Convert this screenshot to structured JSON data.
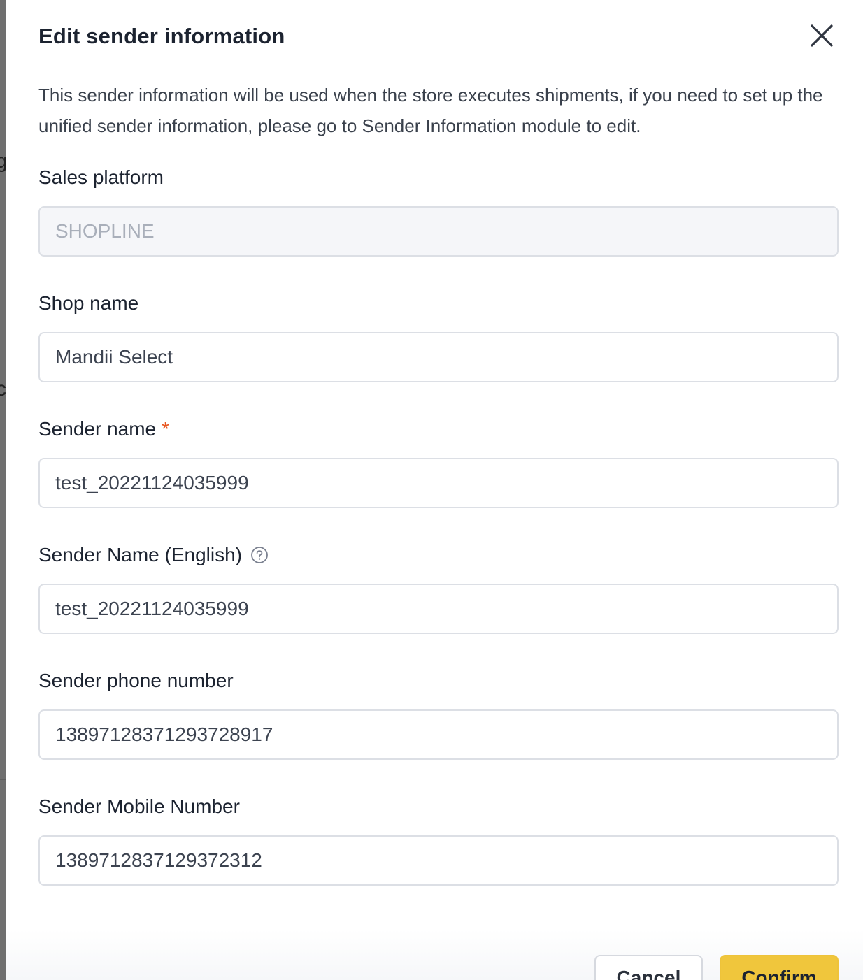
{
  "dialog": {
    "title": "Edit sender information",
    "description": "This sender information will be used when the store executes shipments, if you need to set up the unified sender information, please go to Sender Information module to edit."
  },
  "background": {
    "fragments": [
      "g",
      "c"
    ]
  },
  "fields": {
    "sales_platform": {
      "label": "Sales platform",
      "value": "SHOPLINE",
      "disabled": true
    },
    "shop_name": {
      "label": "Shop name",
      "value": "Mandii Select"
    },
    "sender_name": {
      "label": "Sender name",
      "required_mark": "*",
      "value": "test_20221124035999"
    },
    "sender_name_english": {
      "label": "Sender Name (English)",
      "value": "test_20221124035999"
    },
    "sender_phone": {
      "label": "Sender phone number",
      "value": "13897128371293728917"
    },
    "sender_mobile": {
      "label": "Sender Mobile Number",
      "value": "1389712837129372312"
    }
  },
  "footer": {
    "cancel_label": "Cancel",
    "confirm_label": "Confirm"
  },
  "icons": {
    "close": "close-icon",
    "help": "question-circle-icon"
  },
  "colors": {
    "confirm_button": "#f0c63c",
    "required_star": "#e8541e",
    "input_border": "#dcdfe5",
    "disabled_input_bg": "#f5f6f9"
  }
}
